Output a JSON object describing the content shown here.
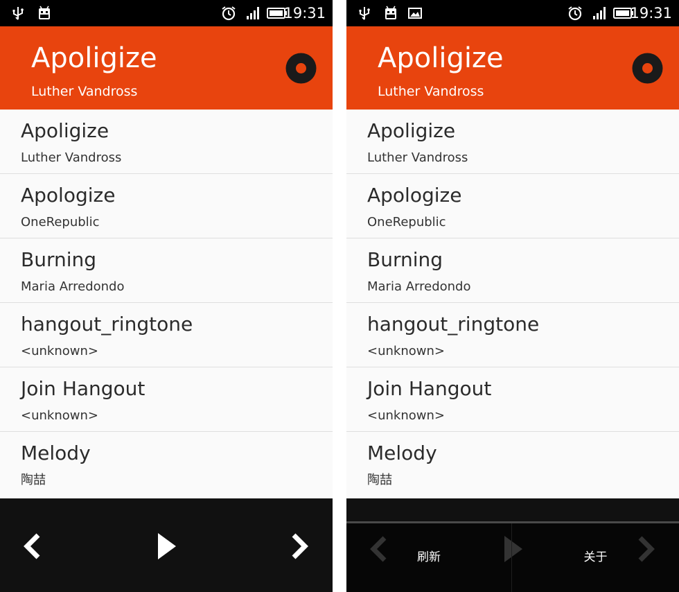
{
  "status_bar": {
    "time": "19:31",
    "left_icons": [
      "usb-icon",
      "android-debug-icon"
    ],
    "left_icons_right_screen": [
      "usb-icon",
      "android-debug-icon",
      "image-notification-icon"
    ],
    "right_icons": [
      "alarm-icon",
      "signal-icon",
      "battery-icon"
    ]
  },
  "now_playing": {
    "title": "Apoligize",
    "artist": "Luther Vandross"
  },
  "songs": [
    {
      "title": "Apoligize",
      "artist": "Luther Vandross"
    },
    {
      "title": "Apologize",
      "artist": "OneRepublic"
    },
    {
      "title": "Burning",
      "artist": "Maria Arredondo"
    },
    {
      "title": "hangout_ringtone",
      "artist": "<unknown>"
    },
    {
      "title": "Join Hangout",
      "artist": "<unknown>"
    },
    {
      "title": "Melody",
      "artist": "陶喆"
    }
  ],
  "controls": [
    "prev-icon",
    "play-icon",
    "next-icon"
  ],
  "menu": {
    "refresh": "刷新",
    "about": "关于"
  },
  "colors": {
    "accent": "#e8440e",
    "player_bg": "#111111",
    "list_bg": "#fafafa"
  }
}
